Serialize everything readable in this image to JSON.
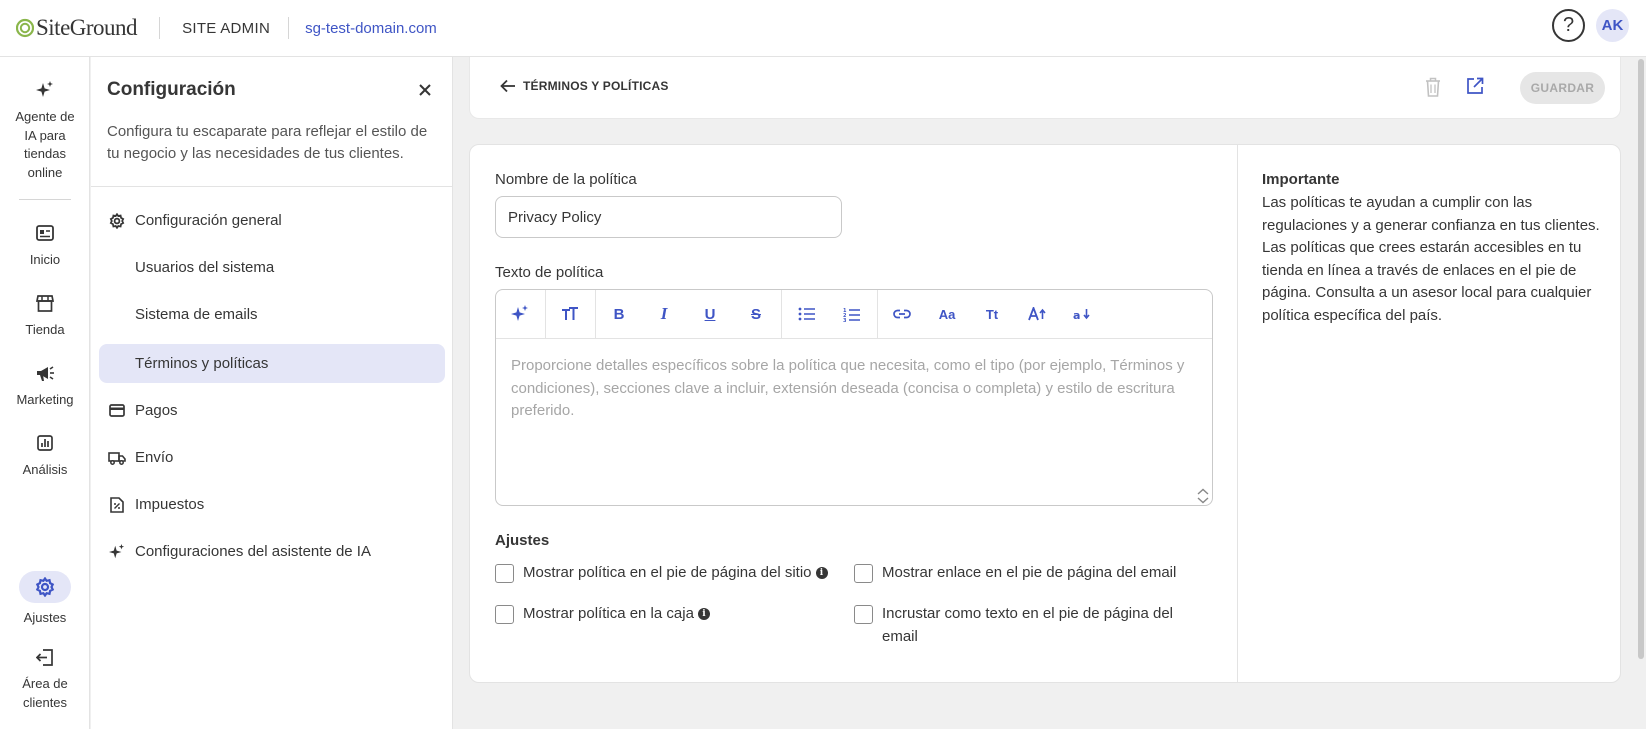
{
  "topbar": {
    "logo_text": "SiteGround",
    "site_admin": "SITE ADMIN",
    "domain": "sg-test-domain.com",
    "help_label": "?",
    "avatar_initials": "AK"
  },
  "rail": {
    "ai_agent": "Agente de IA para tiendas online",
    "home": "Inicio",
    "store": "Tienda",
    "marketing": "Marketing",
    "analytics": "Análisis",
    "settings": "Ajustes",
    "client_area": "Área de clientes"
  },
  "settings_panel": {
    "title": "Configuración",
    "description": "Configura tu escaparate para reflejar el estilo de tu negocio y las necesidades de tus clientes.",
    "items": [
      {
        "label": "Configuración general",
        "icon": "gear-icon"
      },
      {
        "label": "Usuarios del sistema"
      },
      {
        "label": "Sistema de emails"
      },
      {
        "label": "Términos y políticas",
        "active": true
      },
      {
        "label": "Pagos",
        "icon": "credit-card-icon"
      },
      {
        "label": "Envío",
        "icon": "truck-icon"
      },
      {
        "label": "Impuestos",
        "icon": "tax-document-icon"
      },
      {
        "label": "Configuraciones del asistente de IA",
        "icon": "sparkle-icon"
      }
    ]
  },
  "header": {
    "back_label": "TÉRMINOS Y POLÍTICAS",
    "save_label": "GUARDAR"
  },
  "form": {
    "policy_name_label": "Nombre de la política",
    "policy_name_value": "Privacy Policy",
    "policy_text_label": "Texto de política",
    "policy_text_placeholder": "Proporcione detalles específicos sobre la política que necesita, como el tipo (por ejemplo, Términos y condiciones), secciones clave a incluir, extensión deseada (concisa o completa) y estilo de escritura preferido.",
    "settings_heading": "Ajustes",
    "checkboxes": {
      "show_in_site_footer": "Mostrar política en el pie de página del sitio",
      "show_link_in_email_footer": "Mostrar enlace en el pie de página del email",
      "show_in_checkout": "Mostrar política en la caja",
      "embed_in_email_footer": "Incrustar como texto en el pie de página del email"
    }
  },
  "toolbar_icons": [
    "sparkle-icon",
    "text-size-icon",
    "bold-icon",
    "italic-icon",
    "underline-icon",
    "strikethrough-icon",
    "bullet-list-icon",
    "numbered-list-icon",
    "link-icon",
    "font-case-icon",
    "title-case-icon",
    "font-increase-icon",
    "font-decrease-icon"
  ],
  "toolbar_glyphs": {
    "bold": "B",
    "italic": "I",
    "underline": "U",
    "strike": "S",
    "font_case": "Aa",
    "title_case": "Tt"
  },
  "aside": {
    "title": "Importante",
    "text": "Las políticas te ayudan a cumplir con las regulaciones y a generar confianza en tus clientes. Las políticas que crees estarán accesibles en tu tienda en línea a través de enlaces en el pie de página. Consulta a un asesor local para cualquier política específica del país."
  },
  "colors": {
    "accent": "#3f55c5",
    "active_bg": "#e4e6f7",
    "logo_green": "#8ab64b"
  }
}
